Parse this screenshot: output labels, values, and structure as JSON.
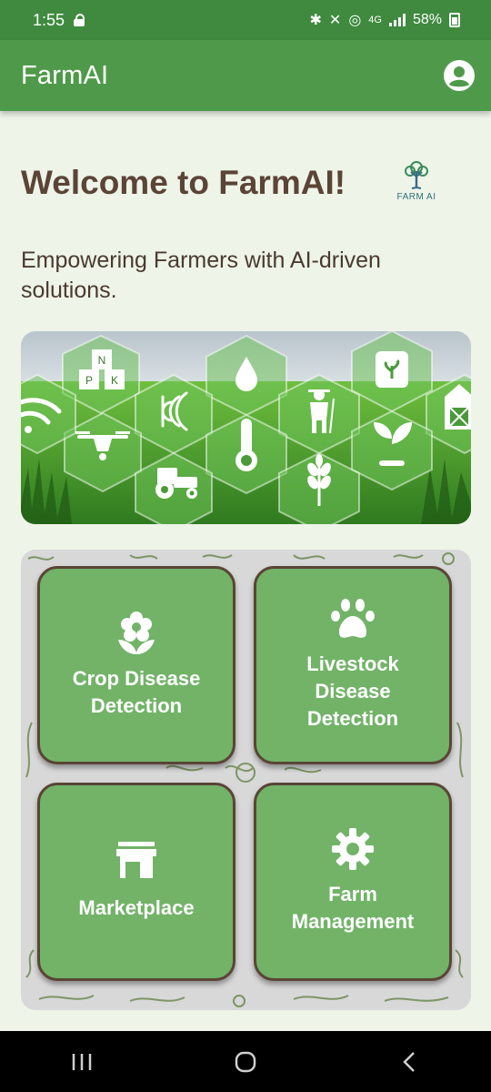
{
  "status_bar": {
    "time": "1:55",
    "network": "4G",
    "battery": "58%"
  },
  "app_bar": {
    "title": "FarmAI"
  },
  "welcome": {
    "title": "Welcome to FarmAI!",
    "logo_text": "FARM AI",
    "tagline": "Empowering Farmers with AI-driven solutions."
  },
  "banner": {
    "npk_letters": [
      "N",
      "P",
      "K"
    ]
  },
  "tiles": [
    {
      "label": "Crop Disease Detection",
      "icon": "flower-icon"
    },
    {
      "label": "Livestock Disease Detection",
      "icon": "paw-icon"
    },
    {
      "label": "Marketplace",
      "icon": "store-icon"
    },
    {
      "label": "Farm Management",
      "icon": "gear-icon"
    }
  ],
  "colors": {
    "status_bar": "#3f8a3f",
    "app_bar": "#4f9a4a",
    "background": "#eef4e8",
    "tile": "#72b368",
    "tile_border": "#5a4535",
    "heading": "#5b4436"
  }
}
